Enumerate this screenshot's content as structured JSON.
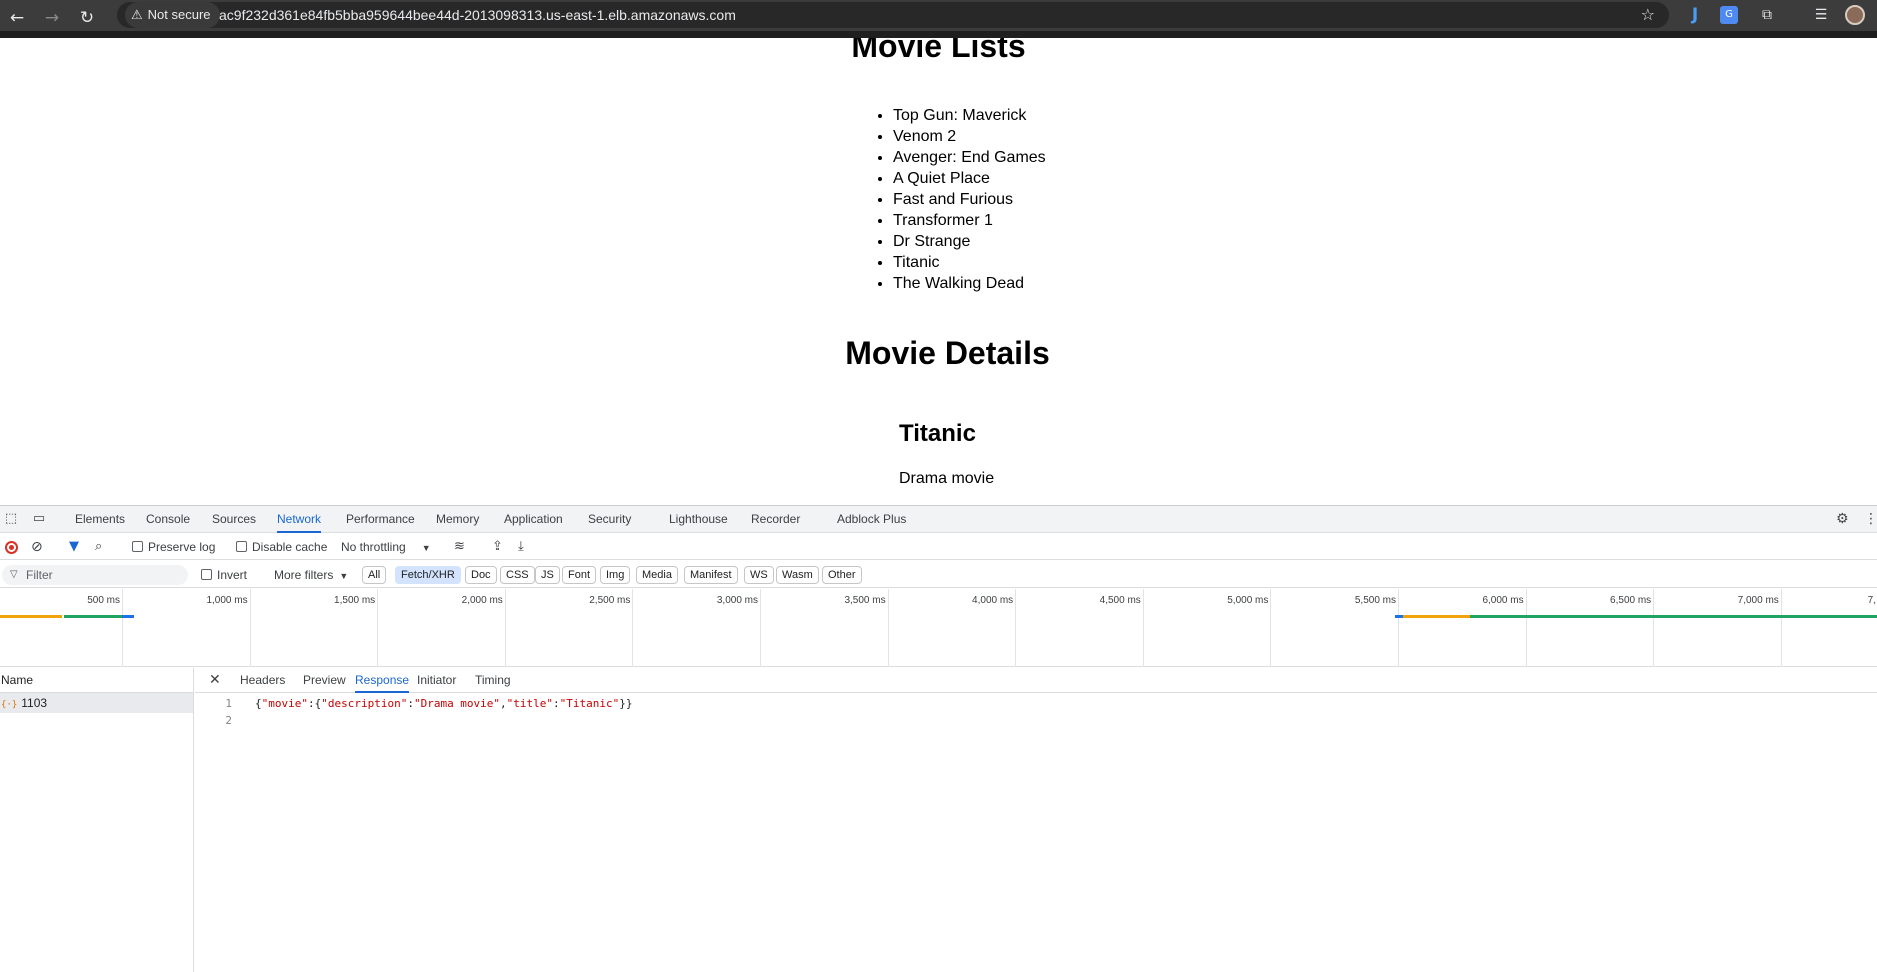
{
  "browser": {
    "security_label": "Not secure",
    "url": "ac9f232d361e84fb5bba959644bee44d-2013098313.us-east-1.elb.amazonaws.com"
  },
  "page": {
    "lists_heading": "Movie Lists",
    "movies": [
      "Top Gun: Maverick",
      "Venom 2",
      "Avenger: End Games",
      "A Quiet Place",
      "Fast and Furious",
      "Transformer 1",
      "Dr Strange",
      "Titanic",
      "The Walking Dead"
    ],
    "details_heading": "Movie Details",
    "selected_title": "Titanic",
    "selected_description": "Drama movie"
  },
  "devtools": {
    "tabs": [
      "Elements",
      "Console",
      "Sources",
      "Network",
      "Performance",
      "Memory",
      "Application",
      "Security",
      "Lighthouse",
      "Recorder",
      "Adblock Plus"
    ],
    "active_tab": "Network",
    "network_bar": {
      "preserve_log": "Preserve log",
      "disable_cache": "Disable cache",
      "throttling": "No throttling"
    },
    "filter": {
      "placeholder": "Filter",
      "invert": "Invert",
      "more_filters": "More filters",
      "types": [
        "All",
        "Fetch/XHR",
        "Doc",
        "CSS",
        "JS",
        "Font",
        "Img",
        "Media",
        "Manifest",
        "WS",
        "Wasm",
        "Other"
      ],
      "active_type": "Fetch/XHR"
    },
    "timeline_ticks": [
      "500 ms",
      "1,000 ms",
      "1,500 ms",
      "2,000 ms",
      "2,500 ms",
      "3,000 ms",
      "3,500 ms",
      "4,000 ms",
      "4,500 ms",
      "5,000 ms",
      "5,500 ms",
      "6,000 ms",
      "6,500 ms",
      "7,000 ms",
      "7,"
    ],
    "name_header": "Name",
    "request_name": "1103",
    "detail_tabs": [
      "Headers",
      "Preview",
      "Response",
      "Initiator",
      "Timing"
    ],
    "active_detail_tab": "Response",
    "response_lines": [
      "1",
      "2"
    ],
    "response_json": {
      "open": "{",
      "k_movie": "\"movie\"",
      "colon_open": ":{",
      "k_description": "\"description\"",
      "colon": ":",
      "v_description": "\"Drama movie\"",
      "comma": ",",
      "k_title": "\"title\"",
      "v_title": "\"Titanic\"",
      "close": "}}"
    },
    "colors": {
      "active_blue": "#1a67d2",
      "waterfall_orange": "#f0a30a",
      "waterfall_green": "#1fa463",
      "waterfall_blue": "#1a73e8"
    }
  }
}
